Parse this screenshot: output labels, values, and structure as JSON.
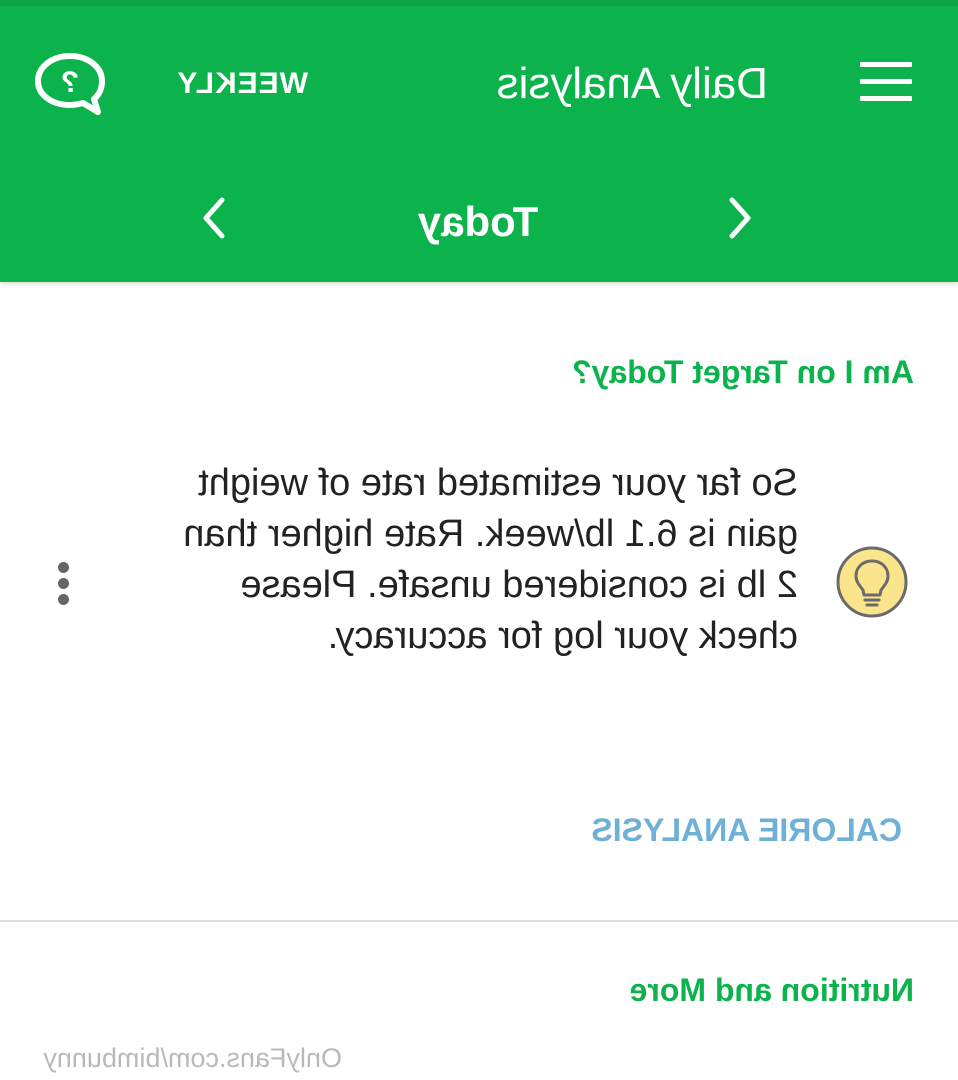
{
  "header": {
    "title": "Daily Analysis",
    "weekly_label": "WEEKLY",
    "menu_icon": "hamburger-menu-icon",
    "help_icon": "help-chat-bubble-icon",
    "background_color": "#0cb34c"
  },
  "date_nav": {
    "current_label": "Today",
    "prev_icon": "chevron-left-icon",
    "next_icon": "chevron-right-icon"
  },
  "target_section": {
    "title": "Am I on Target Today?",
    "insight_icon": "lightbulb-icon",
    "message": "So far your estimated rate of weight gain is 6.1 lb/week. Rate higher than 2 lb is considered unsafe. Please check your log for accuracy.",
    "link_label": "CALORIE ANALYSIS",
    "link_color": "#6fb0d6"
  },
  "nutrition_section": {
    "title": "Nutrition and More"
  },
  "watermark": "OnlyFans.com/bimbunny"
}
